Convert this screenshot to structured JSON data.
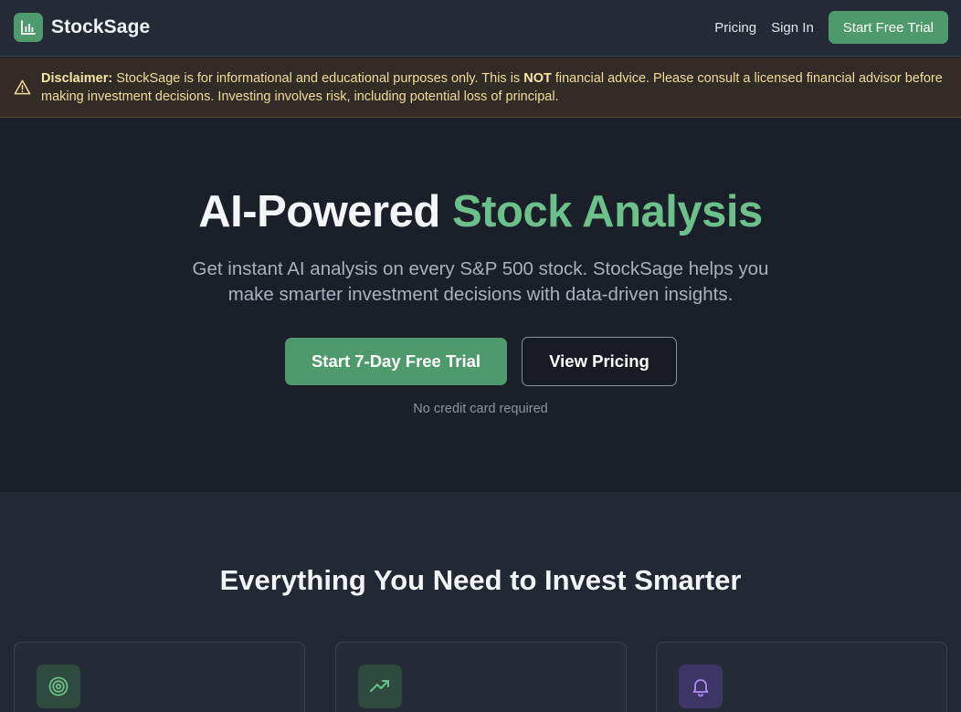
{
  "brand": {
    "name": "StockSage",
    "logo_icon": "bar-chart-icon",
    "accent": "#4f9a6c"
  },
  "nav": {
    "links": [
      {
        "label": "Pricing"
      },
      {
        "label": "Sign In"
      }
    ],
    "cta_label": "Start Free Trial"
  },
  "disclaimer": {
    "icon": "warning-icon",
    "label": "Disclaimer:",
    "text_before": "StockSage is for informational and educational purposes only. This is",
    "emphasis": "NOT",
    "text_after": "financial advice. Please consult a licensed financial advisor before making investment decisions. Investing involves risk, including potential loss of principal."
  },
  "hero": {
    "title_plain": "AI-Powered",
    "title_accent": "Stock Analysis",
    "subtitle": "Get instant AI analysis on every S&P 500 stock. StockSage helps you make smarter investment decisions with data-driven insights.",
    "primary_cta": "Start 7-Day Free Trial",
    "secondary_cta": "View Pricing",
    "note": "No credit card required"
  },
  "features": {
    "title": "Everything You Need to Invest Smarter",
    "cards": [
      {
        "icon": "target-icon",
        "icon_color": "#6cc08a",
        "icon_bg": "#2f4a3e"
      },
      {
        "icon": "trending-up-icon",
        "icon_color": "#6cc08a",
        "icon_bg": "#2f4a3e"
      },
      {
        "icon": "bell-icon",
        "icon_color": "#b08cf0",
        "icon_bg": "#3d3566"
      }
    ]
  }
}
